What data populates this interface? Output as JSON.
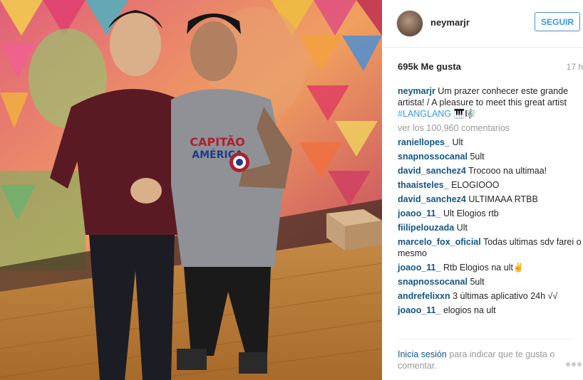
{
  "post": {
    "username": "neymarjr",
    "follow_label": "SEGUIR",
    "likes": "695k Me gusta",
    "time": "17 h",
    "caption": {
      "user": "neymarjr",
      "text": "Um prazer conhecer este grande artista! / A pleasure to meet this great artist ",
      "tag": "#LANGLANG",
      "emoji": "🎹🎼"
    },
    "view_all": "ver los 100,960 comentarios",
    "comments": [
      {
        "user": "raniellopes_",
        "text": "Ult"
      },
      {
        "user": "snapnossocanal",
        "text": "5ult"
      },
      {
        "user": "david_sanchez4",
        "text": "Trocooo na ultimaa!"
      },
      {
        "user": "thaaisteles_",
        "text": "ELOGIOOO"
      },
      {
        "user": "david_sanchez4",
        "text": "ULTIMAAA RTBB"
      },
      {
        "user": "joaoo_11_",
        "text": "Ult Elogios rtb"
      },
      {
        "user": "fiilipelouzada",
        "text": "Ult"
      },
      {
        "user": "marcelo_fox_oficial",
        "text": "Todas ultimas sdv farei o mesmo"
      },
      {
        "user": "joaoo_11_",
        "text": "Rtb Elogios na ult✌"
      },
      {
        "user": "snapnossocanal",
        "text": "5ult"
      },
      {
        "user": "andrefelixxn",
        "text": "3 últimas aplicativo 24h √√"
      },
      {
        "user": "joaoo_11_",
        "text": "elogios na ult"
      }
    ],
    "login_link": "Inicia sesión",
    "login_text": " para indicar que te gusta o comentar."
  },
  "photo": {
    "shirt_text_line1": "CAPITÃO",
    "shirt_text_line2": "AMÉRICA"
  },
  "colors": {
    "link": "#125688",
    "button": "#3897f0",
    "muted": "#999999"
  }
}
